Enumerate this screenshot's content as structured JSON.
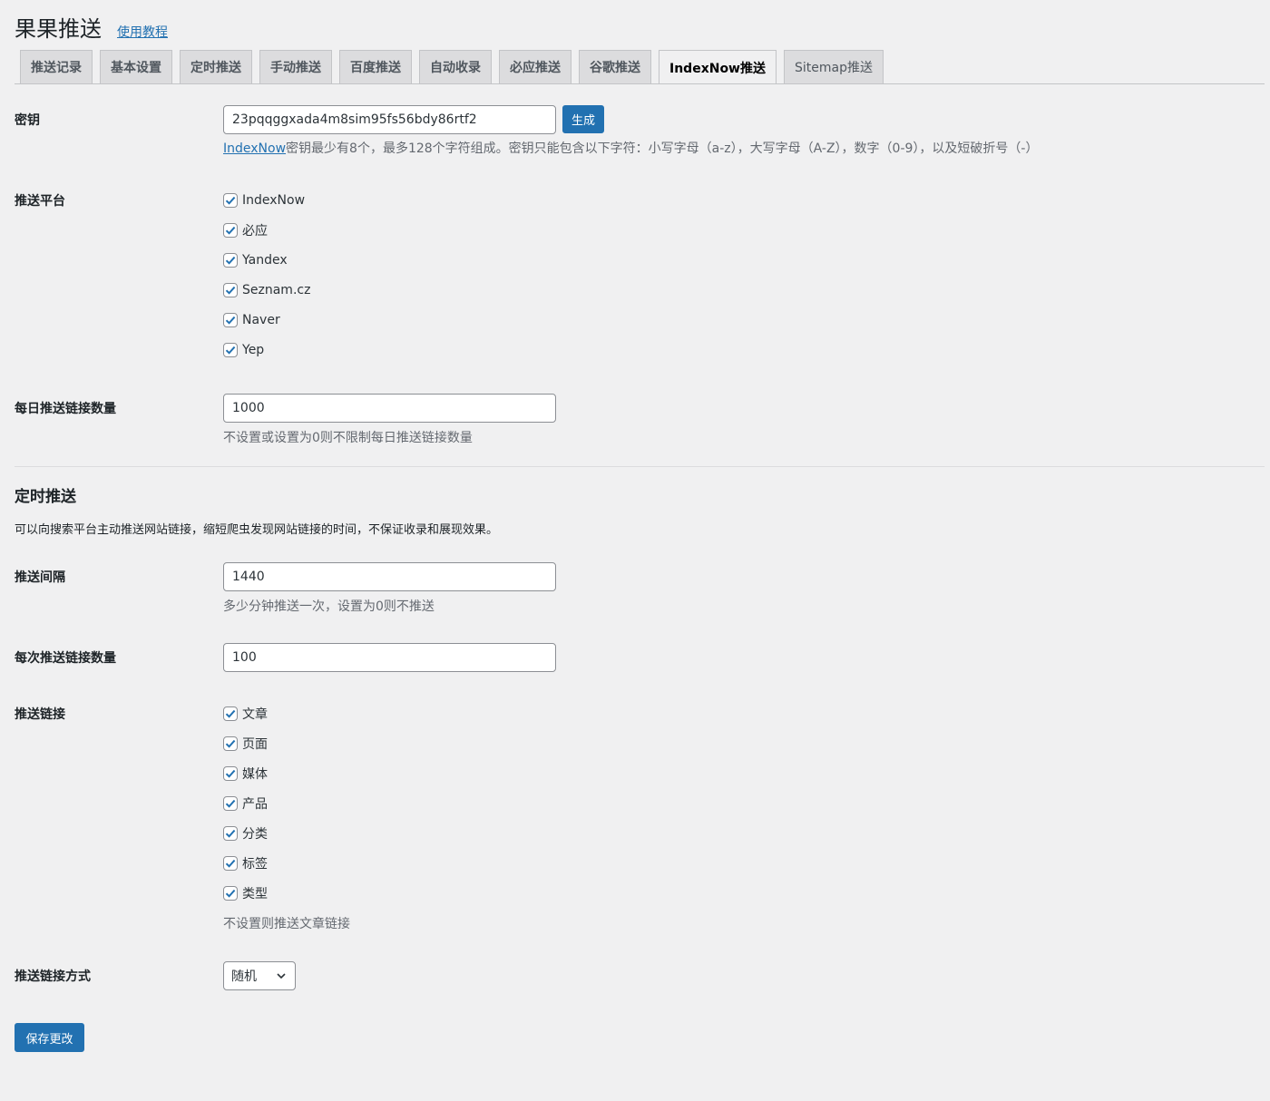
{
  "header": {
    "title": "果果推送",
    "tutorial_link": "使用教程"
  },
  "tabs": [
    {
      "label": "推送记录",
      "active": false
    },
    {
      "label": "基本设置",
      "active": false
    },
    {
      "label": "定时推送",
      "active": false
    },
    {
      "label": "手动推送",
      "active": false
    },
    {
      "label": "百度推送",
      "active": false
    },
    {
      "label": "自动收录",
      "active": false
    },
    {
      "label": "必应推送",
      "active": false
    },
    {
      "label": "谷歌推送",
      "active": false
    },
    {
      "label": "IndexNow推送",
      "active": true
    },
    {
      "label": "Sitemap推送",
      "active": false
    }
  ],
  "key": {
    "label": "密钥",
    "value": "23pqqggxada4m8sim95fs56bdy86rtf2",
    "generate_button": "生成",
    "desc_link": "IndexNow",
    "desc_text": "密钥最少有8个，最多128个字符组成。密钥只能包含以下字符：小写字母（a-z），大写字母（A-Z），数字（0-9），以及短破折号（-）"
  },
  "platforms": {
    "label": "推送平台",
    "items": [
      {
        "label": "IndexNow",
        "checked": true
      },
      {
        "label": "必应",
        "checked": true
      },
      {
        "label": "Yandex",
        "checked": true
      },
      {
        "label": "Seznam.cz",
        "checked": true
      },
      {
        "label": "Naver",
        "checked": true
      },
      {
        "label": "Yep",
        "checked": true
      }
    ]
  },
  "daily_limit": {
    "label": "每日推送链接数量",
    "value": "1000",
    "desc": "不设置或设置为0则不限制每日推送链接数量"
  },
  "schedule_section": {
    "title": "定时推送",
    "desc": "可以向搜索平台主动推送网站链接，缩短爬虫发现网站链接的时间，不保证收录和展现效果。"
  },
  "interval": {
    "label": "推送间隔",
    "value": "1440",
    "desc": "多少分钟推送一次，设置为0则不推送"
  },
  "per_push": {
    "label": "每次推送链接数量",
    "value": "100"
  },
  "link_types": {
    "label": "推送链接",
    "items": [
      {
        "label": "文章",
        "checked": true
      },
      {
        "label": "页面",
        "checked": true
      },
      {
        "label": "媒体",
        "checked": true
      },
      {
        "label": "产品",
        "checked": true
      },
      {
        "label": "分类",
        "checked": true
      },
      {
        "label": "标签",
        "checked": true
      },
      {
        "label": "类型",
        "checked": true
      }
    ],
    "desc": "不设置则推送文章链接"
  },
  "push_method": {
    "label": "推送链接方式",
    "selected": "随机"
  },
  "save_button": "保存更改",
  "colors": {
    "accent": "#2271b1",
    "background": "#f0f0f1"
  }
}
